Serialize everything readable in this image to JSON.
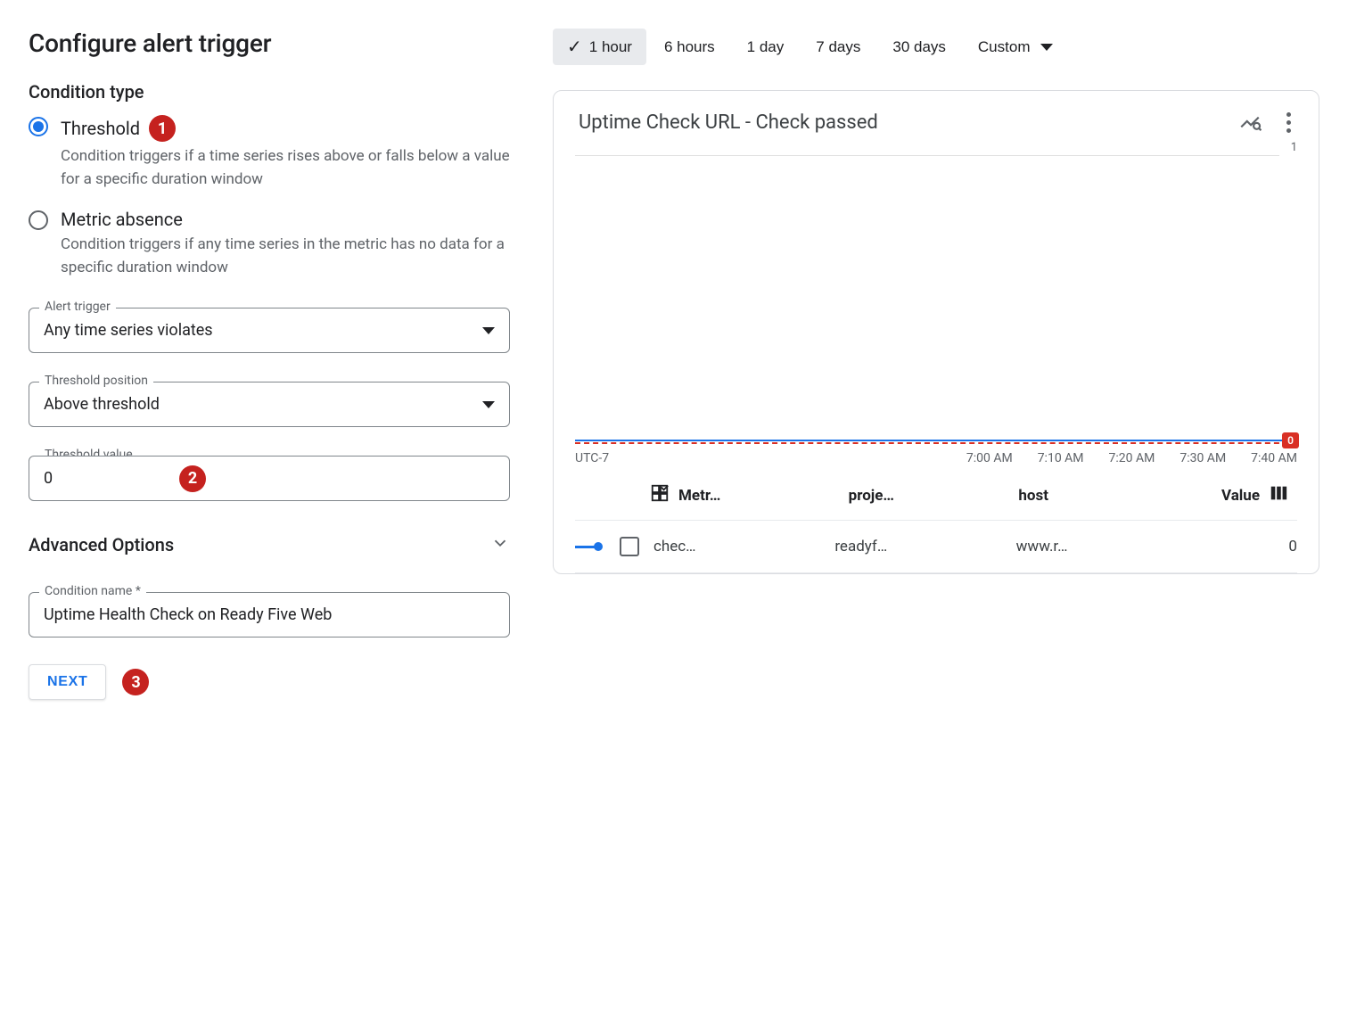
{
  "page": {
    "title": "Configure alert trigger",
    "condition_type_heading": "Condition type"
  },
  "radios": {
    "threshold": {
      "label": "Threshold",
      "desc": "Condition triggers if a time series rises above or falls below a value for a specific duration window",
      "selected": true
    },
    "absence": {
      "label": "Metric absence",
      "desc": "Condition triggers if any time series in the metric has no data for a specific duration window",
      "selected": false
    }
  },
  "fields": {
    "alert_trigger": {
      "legend": "Alert trigger",
      "value": "Any time series violates"
    },
    "threshold_position": {
      "legend": "Threshold position",
      "value": "Above threshold"
    },
    "threshold_value": {
      "legend": "Threshold value",
      "value": "0"
    },
    "condition_name": {
      "legend": "Condition name *",
      "value": "Uptime Health Check on Ready Five Web"
    }
  },
  "advanced": {
    "title": "Advanced Options"
  },
  "actions": {
    "next": "NEXT"
  },
  "step_badges": {
    "one": "1",
    "two": "2",
    "three": "3"
  },
  "time_ranges": [
    "1 hour",
    "6 hours",
    "1 day",
    "7 days",
    "30 days",
    "Custom"
  ],
  "time_range_selected": "1 hour",
  "chart_card": {
    "title": "Uptime Check URL - Check passed",
    "timezone": "UTC-7",
    "x_ticks": [
      "7:00 AM",
      "7:10 AM",
      "7:20 AM",
      "7:30 AM",
      "7:40 AM"
    ],
    "y_tick_top": "1",
    "badge_value": "0"
  },
  "legend": {
    "headers": {
      "metric": "Metr…",
      "project": "proje…",
      "host": "host",
      "value": "Value"
    },
    "row": {
      "metric": "chec…",
      "project": "readyf…",
      "host": "www.r…",
      "value": "0"
    }
  },
  "chart_data": {
    "type": "line",
    "title": "Uptime Check URL - Check passed",
    "xlabel": "",
    "ylabel": "",
    "ylim": [
      0,
      1
    ],
    "x": [
      "7:00 AM",
      "7:10 AM",
      "7:20 AM",
      "7:30 AM",
      "7:40 AM"
    ],
    "series": [
      {
        "name": "check_passed (readyfive / www.r…)",
        "values": [
          0,
          0,
          0,
          0,
          0
        ]
      }
    ],
    "threshold": {
      "value": 0,
      "position": "above"
    }
  }
}
